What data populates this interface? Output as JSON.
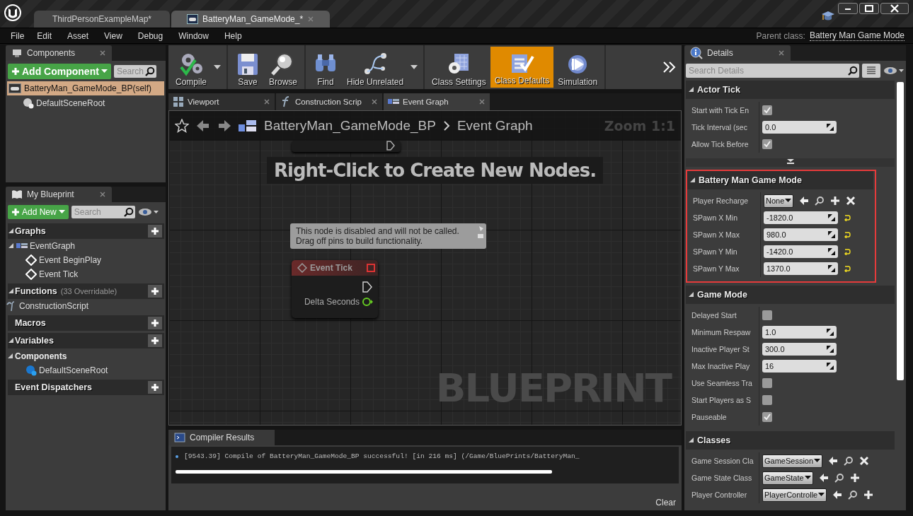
{
  "title_bar": {
    "tabs": [
      {
        "label": "ThirdPersonExampleMap*",
        "kind": "map",
        "selected": false,
        "closable": false
      },
      {
        "label": "BatteryMan_GameMode_*",
        "kind": "blueprint",
        "selected": true,
        "closable": true
      }
    ]
  },
  "menu": [
    "File",
    "Edit",
    "Asset",
    "View",
    "Debug",
    "Window",
    "Help"
  ],
  "parent_class": {
    "label": "Parent class:",
    "value": "Battery Man Game Mode"
  },
  "components_panel": {
    "title": "Components",
    "add_button": "Add Component",
    "search": {
      "placeholder": "Search"
    },
    "tree": [
      {
        "label": "BatteryMan_GameMode_BP(self)",
        "kind": "self",
        "selected": true,
        "children": [
          {
            "label": "DefaultSceneRoot",
            "kind": "scene",
            "selected": false
          }
        ]
      }
    ]
  },
  "my_blueprint": {
    "title": "My Blueprint",
    "add_button": "Add New",
    "search": {
      "placeholder": "Search"
    },
    "sections": [
      {
        "title": "Graphs",
        "expanded": true,
        "items": [
          {
            "label": "EventGraph",
            "kind": "graph",
            "children": [
              {
                "label": "Event BeginPlay",
                "kind": "event"
              },
              {
                "label": "Event Tick",
                "kind": "event"
              }
            ]
          }
        ]
      },
      {
        "title": "Functions",
        "note": "(33 Overridable)",
        "expanded": true,
        "items": [
          {
            "label": "ConstructionScript",
            "kind": "function"
          }
        ]
      },
      {
        "title": "Macros"
      },
      {
        "title": "Variables",
        "expanded": true,
        "items": [
          {
            "label": "Components",
            "kind": "category",
            "children": [
              {
                "label": "DefaultSceneRoot",
                "kind": "component"
              }
            ]
          }
        ]
      },
      {
        "title": "Event Dispatchers"
      }
    ]
  },
  "toolbar": {
    "groups": [
      [
        {
          "label": "Compile",
          "kind": "compile",
          "dropdown": true,
          "selected": false
        }
      ],
      [
        {
          "label": "Save",
          "kind": "save",
          "selected": false
        },
        {
          "label": "Browse",
          "kind": "browse",
          "selected": false
        }
      ],
      [
        {
          "label": "Find",
          "kind": "find",
          "selected": false
        },
        {
          "label": "Hide Unrelated",
          "kind": "hide",
          "dropdown": true,
          "selected": false
        }
      ],
      [
        {
          "label": "Class Settings",
          "kind": "settings",
          "selected": false
        },
        {
          "label": "Class Defaults",
          "kind": "defaults",
          "selected": true
        },
        {
          "label": "Simulation",
          "kind": "simulation",
          "selected": false
        }
      ]
    ]
  },
  "document_tabs": [
    {
      "label": "Viewport",
      "kind": "viewport",
      "selected": false
    },
    {
      "label": "Construction Scrip",
      "kind": "function",
      "selected": false
    },
    {
      "label": "Event Graph",
      "kind": "graph",
      "selected": true
    }
  ],
  "graph": {
    "breadcrumb": [
      "BatteryMan_GameMode_BP",
      "Event Graph"
    ],
    "zoom": "Zoom 1:1",
    "hint": "Right-Click to Create New Nodes.",
    "comment": [
      "This node is disabled and will not be called.",
      "Drag off pins to build functionality."
    ],
    "node": {
      "title": "Event Tick",
      "pin": "Delta Seconds"
    },
    "watermark": "BLUEPRINT"
  },
  "compiler_results": {
    "title": "Compiler Results",
    "messages": [
      "[9543.39] Compile of BatteryMan_GameMode_BP successful! [in 216 ms] (/Game/BluePrints/BatteryMan_"
    ],
    "clear": "Clear"
  },
  "details": {
    "title": "Details",
    "search": {
      "placeholder": "Search Details"
    },
    "categories": [
      {
        "title": "Actor Tick",
        "highlighted": false,
        "advanced": true,
        "rows": [
          {
            "label": "Start with Tick En",
            "kind": "checkbox",
            "checked": true
          },
          {
            "label": "Tick Interval (sec",
            "kind": "number",
            "value": "0.0"
          },
          {
            "label": "Allow Tick Before",
            "kind": "checkbox",
            "checked": true
          }
        ]
      },
      {
        "title": "Battery Man Game Mode",
        "highlighted": true,
        "rows": [
          {
            "label": "Player Recharge",
            "kind": "class",
            "value": "None",
            "actions": [
              {
                "kind": "back"
              },
              {
                "kind": "browse"
              },
              {
                "kind": "add"
              },
              {
                "kind": "clear"
              }
            ]
          },
          {
            "label": "SPawn X Min",
            "kind": "number",
            "value": "-1820.0",
            "reset": true
          },
          {
            "label": "SPawn X Max",
            "kind": "number",
            "value": "980.0",
            "reset": true
          },
          {
            "label": "SPawn Y Min",
            "kind": "number",
            "value": "-1420.0",
            "reset": true
          },
          {
            "label": "SPawn Y Max",
            "kind": "number",
            "value": "1370.0",
            "reset": true
          }
        ]
      },
      {
        "title": "Game Mode",
        "highlighted": false,
        "rows": [
          {
            "label": "Delayed Start",
            "kind": "checkbox",
            "checked": false
          },
          {
            "label": "Minimum Respaw",
            "kind": "number",
            "value": "1.0"
          },
          {
            "label": "Inactive Player St",
            "kind": "number",
            "value": "300.0"
          },
          {
            "label": "Max Inactive Play",
            "kind": "number",
            "value": "16"
          },
          {
            "label": "Use Seamless Tra",
            "kind": "checkbox",
            "checked": false
          },
          {
            "label": "Start Players as S",
            "kind": "checkbox",
            "checked": false
          },
          {
            "label": "Pauseable",
            "kind": "checkbox",
            "checked": true
          }
        ]
      },
      {
        "title": "Classes",
        "highlighted": false,
        "rows": [
          {
            "label": "Game Session Cla",
            "kind": "class",
            "value": "GameSession",
            "actions": [
              {
                "kind": "back"
              },
              {
                "kind": "browse"
              },
              {
                "kind": "clear"
              }
            ]
          },
          {
            "label": "Game State Class",
            "kind": "class",
            "value": "GameState",
            "actions": [
              {
                "kind": "back"
              },
              {
                "kind": "browse"
              },
              {
                "kind": "add"
              }
            ]
          },
          {
            "label": "Player Controller",
            "kind": "class",
            "value": "PlayerControlle",
            "actions": [
              {
                "kind": "back"
              },
              {
                "kind": "browse"
              },
              {
                "kind": "add"
              }
            ]
          }
        ]
      }
    ]
  }
}
